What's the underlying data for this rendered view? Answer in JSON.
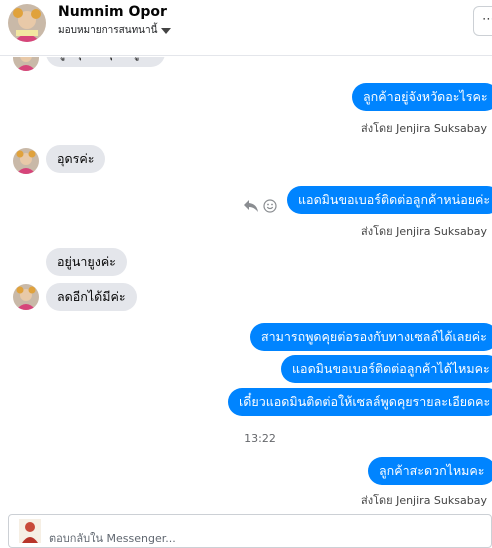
{
  "header": {
    "contact_name": "Numnim Opor",
    "assign_label": "มอบหมายการสนทนานี้",
    "more_label": "⋯"
  },
  "thread": {
    "cutoff_text": "พูดคุยกับคุณอยู่ค่ะ",
    "messages": [
      {
        "direction": "outgoing",
        "text": "ลูกค้าอยู่จังหวัดอะไรคะ"
      },
      {
        "direction": "sender",
        "text": "ส่งโดย Jenjira Suksabay"
      },
      {
        "direction": "incoming",
        "text": "อุดรค่ะ"
      },
      {
        "direction": "outgoing",
        "text": "แอดมินขอเบอร์ติดต่อลูกค้าหน่อยค่ะ"
      },
      {
        "direction": "sender",
        "text": "ส่งโดย Jenjira Suksabay"
      },
      {
        "direction": "incoming",
        "text": "อยู่นายูงค่ะ"
      },
      {
        "direction": "incoming",
        "text": "ลดอีกได้มีค่ะ"
      },
      {
        "direction": "outgoing",
        "text": "สามารถพูดคุยต่อรองกับทางเซลล์ได้เลยค่ะ"
      },
      {
        "direction": "outgoing",
        "text": "แอดมินขอเบอร์ติดต่อลูกค้าได้ไหมคะ"
      },
      {
        "direction": "outgoing",
        "text": "เดี๋ยวแอดมินติดต่อให้เซลล์พูดคุยรายละเอียดคะ"
      },
      {
        "direction": "timestamp",
        "text": "13:22"
      },
      {
        "direction": "outgoing",
        "text": "ลูกค้าสะดวกไหมคะ"
      },
      {
        "direction": "sender",
        "text": "ส่งโดย Jenjira Suksabay"
      }
    ]
  },
  "composer": {
    "placeholder": "ตอบกลับใน Messenger..."
  },
  "colors": {
    "outgoing_bubble": "#0084ff",
    "incoming_bubble": "#e4e6eb",
    "text_muted": "#65676b"
  },
  "icons": [
    "avatar",
    "caret-down-icon",
    "reply-icon",
    "emoji-icon"
  ]
}
